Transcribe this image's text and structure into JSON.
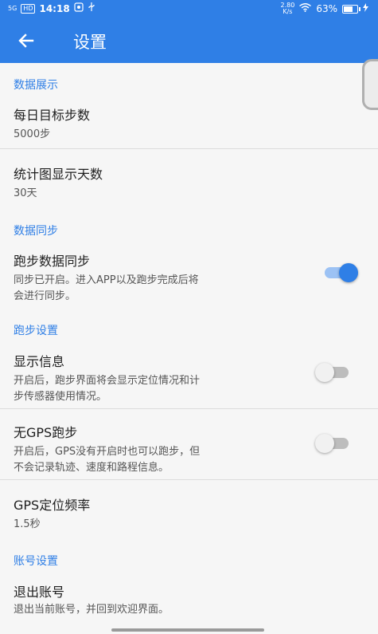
{
  "status_bar": {
    "network": "5G",
    "hd": "HD",
    "time": "14:18",
    "speed_top": "2.80",
    "speed_bottom": "K/s",
    "battery": "63%",
    "battery_level": 0.63
  },
  "header": {
    "title": "设置",
    "back_icon": "arrow-left-icon"
  },
  "sections": [
    {
      "label": "数据展示"
    },
    {
      "label": "数据同步"
    },
    {
      "label": "跑步设置"
    },
    {
      "label": "账号设置"
    }
  ],
  "items": {
    "daily_goal": {
      "title": "每日目标步数",
      "value": "5000步"
    },
    "chart_days": {
      "title": "统计图显示天数",
      "value": "30天"
    },
    "run_sync": {
      "title": "跑步数据同步",
      "desc_line1": "同步已开启。进入APP以及跑步完成后将",
      "desc_line2": "会进行同步。",
      "enabled": true
    },
    "show_info": {
      "title": "显示信息",
      "desc_line1": "开启后，跑步界面将会显示定位情况和计",
      "desc_line2": "步传感器使用情况。",
      "enabled": false
    },
    "no_gps_run": {
      "title": "无GPS跑步",
      "desc_line1": "开启后，GPS没有开启时也可以跑步，但",
      "desc_line2": "不会记录轨迹、速度和路程信息。",
      "enabled": false
    },
    "gps_rate": {
      "title": "GPS定位频率",
      "value": "1.5秒"
    },
    "logout": {
      "title": "退出账号",
      "desc": "退出当前账号，并回到欢迎界面。"
    }
  },
  "colors": {
    "primary": "#2f7fe6",
    "background": "#f6f6f6"
  }
}
